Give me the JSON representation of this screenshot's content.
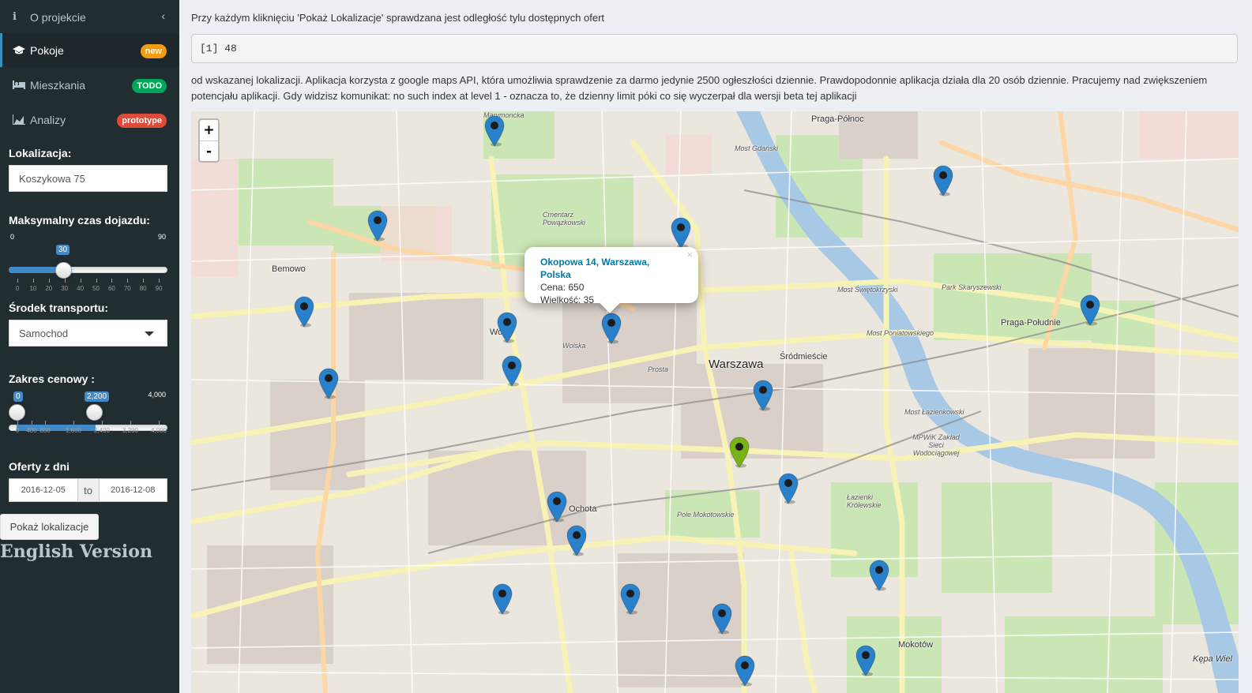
{
  "sidebar": {
    "items": [
      {
        "label": "O projekcie",
        "icon": "info-icon"
      },
      {
        "label": "Pokoje",
        "icon": "graduation-cap-icon",
        "badge": "new",
        "badge_color": "#f39c12"
      },
      {
        "label": "Mieszkania",
        "icon": "bed-icon",
        "badge": "TODO",
        "badge_color": "#00a65a"
      },
      {
        "label": "Analizy",
        "icon": "area-chart-icon",
        "badge": "prototype",
        "badge_color": "#dd4b39"
      }
    ],
    "location_label": "Lokalizacja:",
    "location_value": "Koszykowa 75",
    "time_label": "Maksymalny czas dojazdu:",
    "time_slider": {
      "min": "0",
      "max": "90",
      "value": 30,
      "value_label": "30",
      "ticks": [
        "0",
        "10",
        "20",
        "30",
        "40",
        "50",
        "60",
        "70",
        "80",
        "90"
      ]
    },
    "transport_label": "Środek transportu:",
    "transport_value": "Samochod",
    "price_label": "Zakres cenowy :",
    "price_slider": {
      "min": "0",
      "max": "4,000",
      "from": 0,
      "to": 2200,
      "from_label": "0",
      "to_label": "2,200",
      "ticks": [
        "0",
        "400",
        "800",
        "1,600",
        "2,400",
        "3,200",
        "4,000"
      ]
    },
    "offers_label": "Oferty z dni",
    "date_from": "2016-12-05",
    "date_sep": "to",
    "date_to": "2016-12-08",
    "show_button": "Pokaż lokalizacje",
    "english_link": "English Version"
  },
  "main": {
    "intro": "Przy każdym kliknięciu 'Pokaż Lokalizacje' sprawdzana jest odległość tylu dostępnych ofert",
    "console_output": "[1] 48",
    "info": "od wskazanej lokalizacji. Aplikacja korzysta z google maps API, która umożliwia sprawdzenie za darmo jedynie 2500 ogłeszłości dziennie. Prawdopodonnie aplikacja działa dla 20 osób dziennie. Pracujemy nad zwiększeniem potencjału aplikacji. Gdy widzisz komunikat: no such index at level 1 - oznacza to, że dzienny limit póki co się wyczerpał dla wersji beta tej aplikacji"
  },
  "map": {
    "zoom_in": "+",
    "zoom_out": "-",
    "popup": {
      "title": "Okopowa 14, Warszawa, Polska",
      "price": "Cena: 650",
      "size": "Wielkość: 35",
      "close": "×"
    },
    "labels": {
      "warszawa": "Warszawa",
      "srodmiescie": "Śródmieście",
      "praga_polnoc": "Praga-Północ",
      "praga_poludnie": "Praga-Południe",
      "bemowo": "Bemowo",
      "ochota": "Ochota",
      "mokotow": "Mokotów",
      "wola": "Wola",
      "pole_mokotowskie": "Pole Mokotowskie",
      "lazienki": "Łazienki Królewskie",
      "park_skaryszewski": "Park Skaryszewski",
      "cmentarz": "Cmentarz Powązkowski",
      "kepa": "Kępa Wiel",
      "marymoncka": "Marymoncka",
      "prosta": "Prosta",
      "wolska": "Wolska",
      "most_gdanski": "Most Gdański",
      "most_swietokrzyski": "Most Świętokrzyski",
      "most_poniatowskiego": "Most Poniatowskiego",
      "most_lazienkowski": "Most Łazienkowski",
      "mpwik": "MPWiK Zakład Sieci Wodociągowej"
    },
    "accent_pin_color": "#2a81cb",
    "selected_pin_color": "#7ab317"
  }
}
